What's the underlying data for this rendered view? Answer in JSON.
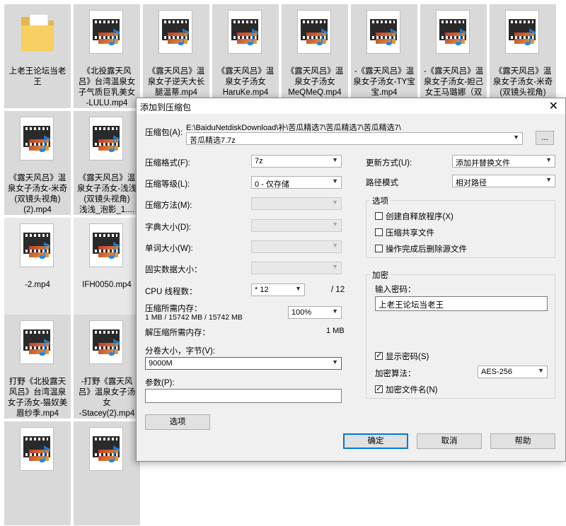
{
  "files": [
    {
      "caption": "上老王论坛当老\n王",
      "type": "folder"
    },
    {
      "caption": "《北投露天风\n吕》台湾温泉女\n子气质巨乳美女\n-LULU.mp4",
      "type": "mp4"
    },
    {
      "caption": "《露天风吕》温\n泉女子逆天大长\n腿温蒂.mp4",
      "type": "mp4"
    },
    {
      "caption": "《露天风吕》温\n泉女子汤女\nHaruKe.mp4",
      "type": "mp4"
    },
    {
      "caption": "《露天风吕》温\n泉女子汤女\nMeQMeQ.mp4",
      "type": "mp4"
    },
    {
      "caption": "-《露天风吕》温\n泉女子汤女-TY宝\n宝.mp4",
      "type": "mp4"
    },
    {
      "caption": "-《露天风吕》温\n泉女子汤女-妲己\n女王马璐娜（双",
      "type": "mp4"
    },
    {
      "caption": "《露天风吕》温\n泉女子汤女-米奇\n(双镜头视角)",
      "type": "mp4"
    },
    {
      "caption": "《露天风吕》温\n泉女子汤女-米奇\n(双镜头视角)\n(2).mp4",
      "type": "mp4"
    },
    {
      "caption": "《露天风吕》温\n泉女子汤女-浅浅\n(双镜头视角)\n浅浅_泡影_1....",
      "type": "mp4"
    },
    {
      "caption": "-2.mp4",
      "type": "mp4"
    },
    {
      "caption": "IFH0050.mp4",
      "type": "mp4"
    },
    {
      "caption": "打野《北投露天\n风吕》台湾温泉\n女子汤女-猫奴美\n眉纱季.mp4",
      "type": "mp4"
    },
    {
      "caption": "-打野《露天风\n吕》温泉女子汤\n女\n-Stacey(2).mp4",
      "type": "mp4"
    },
    {
      "caption": "",
      "type": "mp4"
    },
    {
      "caption": "",
      "type": "mp4"
    }
  ],
  "dialog": {
    "title": "添加到压缩包",
    "close_icon": "close-icon",
    "archive_label": "压缩包(A):",
    "archive_path": "E:\\BaiduNetdiskDownload\\补\\苦瓜精选7\\苦瓜精选7\\苦瓜精选7\\",
    "archive_name": "苦瓜精选7.7z",
    "browse_label": "...",
    "format_label": "压缩格式(F):",
    "format_value": "7z",
    "level_label": "压缩等级(L):",
    "level_value": "0 - 仅存储",
    "method_label": "压缩方法(M):",
    "dict_label": "字典大小(D):",
    "word_label": "单词大小(W):",
    "solid_label": "固实数据大小：",
    "cpu_label": "CPU 线程数：",
    "cpu_value": "* 12",
    "cpu_max": "/ 12",
    "mem_label": "压缩所需内存：",
    "mem_detail": "1 MB / 15742 MB / 15742 MB",
    "mem_percent": "100%",
    "demem_label": "解压缩所需内存：",
    "demem_value": "1 MB",
    "split_label": "分卷大小，字节(V):",
    "split_value": "9000M",
    "params_label": "参数(P):",
    "params_value": "",
    "options_button": "选项",
    "update_label": "更新方式(U):",
    "update_value": "添加并替换文件",
    "path_label": "路径模式",
    "path_value": "相对路径",
    "options_group": "选项",
    "opt_sfx": "创建自释放程序(X)",
    "opt_shared": "压缩共享文件",
    "opt_delete": "操作完成后删除源文件",
    "encrypt_group": "加密",
    "password_label": "输入密码：",
    "password_value": "上老王论坛当老王",
    "show_password": "显示密码(S)",
    "enc_method_label": "加密算法：",
    "enc_method_value": "AES-256",
    "encrypt_names": "加密文件名(N)",
    "ok_button": "确定",
    "cancel_button": "取消",
    "help_button": "帮助"
  }
}
